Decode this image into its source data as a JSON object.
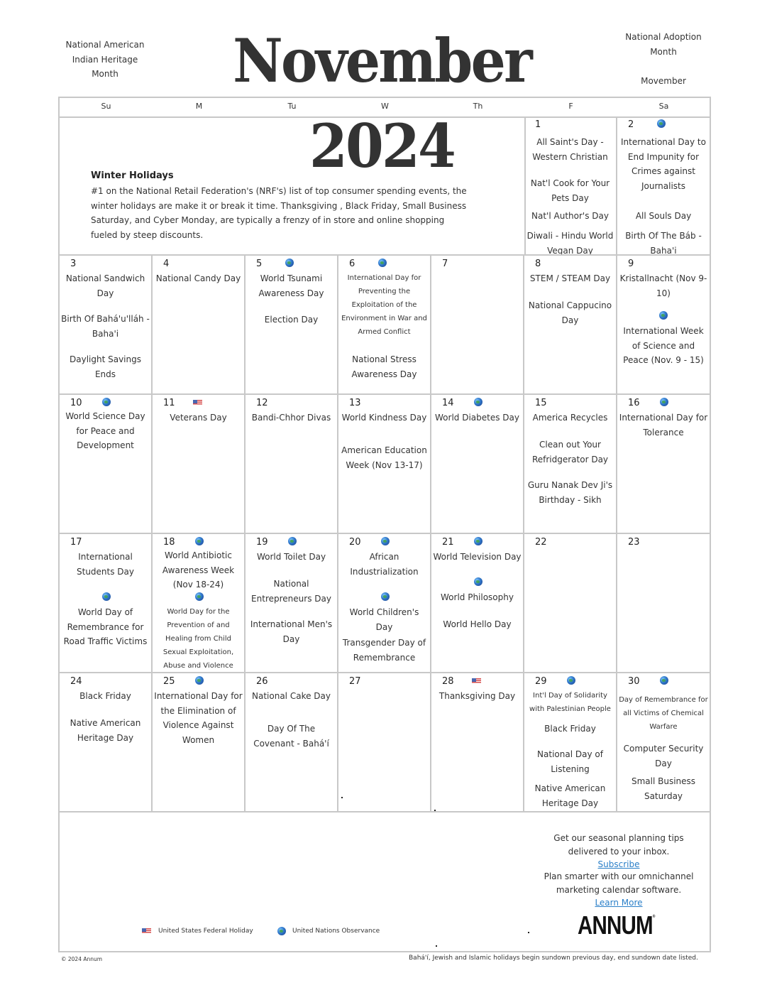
{
  "header": {
    "title": "November 2024",
    "left_note": [
      "National American",
      "Indian Heritage",
      "Month"
    ],
    "right_note": [
      "National Adoption",
      "Month",
      "",
      "Movember"
    ]
  },
  "weekdays": [
    "Su",
    "M",
    "Tu",
    "W",
    "Th",
    "F",
    "Sa"
  ],
  "feature": {
    "title": "Winter Holidays",
    "body": "#1 on the National Retail Federation's (NRF's) list of top consumer spending events, the winter holidays are make it or break it time. Thanksgiving , Black Friday, Small Business Saturday, and Cyber Monday, are typically a frenzy of in store and online shopping fueled by steep discounts."
  },
  "days": {
    "1": {
      "num": "1",
      "marker": "",
      "events": [
        "All Saint's Day - Western Christian",
        "Nat'l Cook for Your Pets Day",
        "Nat'l Author's Day",
        "Diwali - Hindu World Vegan Day"
      ]
    },
    "2": {
      "num": "2",
      "marker": "globe",
      "events": [
        "International Day to End Impunity for Crimes against Journalists",
        "All Souls Day",
        "Birth Of The Báb - Baha'i"
      ]
    },
    "3": {
      "num": "3",
      "marker": "",
      "events": [
        "National Sandwich Day",
        "Birth Of Bahá'u'lláh - Baha'i",
        "Daylight Savings Ends"
      ]
    },
    "4": {
      "num": "4",
      "marker": "",
      "events": [
        "National Candy Day"
      ]
    },
    "5": {
      "num": "5",
      "marker": "globe",
      "events": [
        "World Tsunami Awareness Day",
        "Election Day"
      ]
    },
    "6": {
      "num": "6",
      "marker": "globe",
      "events": [
        "International Day for Preventing the Exploitation of the Environment in War and Armed Conflict",
        "National Stress Awareness Day"
      ]
    },
    "7": {
      "num": "7",
      "marker": "",
      "events": []
    },
    "8": {
      "num": "8",
      "marker": "",
      "events": [
        "STEM / STEAM Day",
        "National Cappucino Day"
      ]
    },
    "9": {
      "num": "9",
      "marker": "",
      "events": [
        "Kristallnacht (Nov 9-10)",
        "International Week of Science and Peace (Nov. 9 - 15)"
      ]
    },
    "10": {
      "num": "10",
      "marker": "globe",
      "events": [
        "World Science Day for Peace and Development"
      ]
    },
    "11": {
      "num": "11",
      "marker": "flag",
      "events": [
        "Veterans Day"
      ]
    },
    "12": {
      "num": "12",
      "marker": "",
      "events": [
        "Bandi-Chhor Divas"
      ]
    },
    "13": {
      "num": "13",
      "marker": "",
      "events": [
        "World Kindness Day",
        "American Education Week (Nov 13-17)"
      ]
    },
    "14": {
      "num": "14",
      "marker": "globe",
      "events": [
        "World Diabetes Day"
      ]
    },
    "15": {
      "num": "15",
      "marker": "",
      "events": [
        "America Recycles",
        "Clean out Your Refridgerator Day",
        "Guru Nanak Dev Ji's Birthday - Sikh"
      ]
    },
    "16": {
      "num": "16",
      "marker": "globe",
      "events": [
        "International Day for Tolerance"
      ]
    },
    "17": {
      "num": "17",
      "marker": "",
      "events": [
        "International Students Day",
        "World Day of Remembrance for Road Traffic Victims"
      ]
    },
    "18": {
      "num": "18",
      "marker": "globe",
      "events": [
        "World Antibiotic Awareness Week (Nov 18-24)",
        "World Day for the Prevention of and Healing from Child Sexual Exploitation, Abuse and Violence"
      ]
    },
    "19": {
      "num": "19",
      "marker": "globe",
      "events": [
        "World Toilet Day",
        "National Entrepreneurs Day",
        "International Men's Day"
      ]
    },
    "20": {
      "num": "20",
      "marker": "globe",
      "events": [
        "African Industrialization",
        "World Children's Day",
        "Transgender Day of Remembrance"
      ]
    },
    "21": {
      "num": "21",
      "marker": "globe",
      "events": [
        "World Television Day",
        "World Philosophy",
        "World Hello Day"
      ]
    },
    "22": {
      "num": "22",
      "marker": "",
      "events": []
    },
    "23": {
      "num": "23",
      "marker": "",
      "events": []
    },
    "24": {
      "num": "24",
      "marker": "",
      "events": [
        "Black Friday",
        "Native American Heritage Day"
      ]
    },
    "25": {
      "num": "25",
      "marker": "globe",
      "events": [
        "International Day for the Elimination of Violence Against Women"
      ]
    },
    "26": {
      "num": "26",
      "marker": "",
      "events": [
        "National Cake Day",
        "Day Of The Covenant  - Bahá'í"
      ]
    },
    "27": {
      "num": "27",
      "marker": "",
      "events": []
    },
    "28": {
      "num": "28",
      "marker": "flag",
      "events": [
        "Thanksgiving Day"
      ]
    },
    "29": {
      "num": "29",
      "marker": "globe",
      "events": [
        "Int'l Day of Solidarity with Palestinian People",
        "Black Friday",
        "National Day of Listening",
        "Native American Heritage Day"
      ]
    },
    "30": {
      "num": "30",
      "marker": "globe",
      "events": [
        "Day of Remembrance for all Victims of Chemical Warfare",
        "Computer Security Day",
        "Small Business Saturday"
      ]
    }
  },
  "promo": {
    "line1": "Get our seasonal planning tips delivered to your inbox.",
    "subscribe_link": "Subscribe",
    "line2": "Plan smarter with our omnichannel marketing calendar software.",
    "learn_more_link": "Learn More",
    "logo": "ANNUM",
    "logo_mark": "®"
  },
  "legend": {
    "federal": "United States Federal Holiday",
    "un": "United Nations Observance"
  },
  "footer": {
    "copyright": "© 2024 Annum",
    "disclaimer": "Bahá'í, Jewish and Islamic holidays begin sundown previous day, end sundown date listed."
  },
  "colors": {
    "grid": "#c8c8c8",
    "text": "#333333",
    "link": "#2a7fc8"
  }
}
